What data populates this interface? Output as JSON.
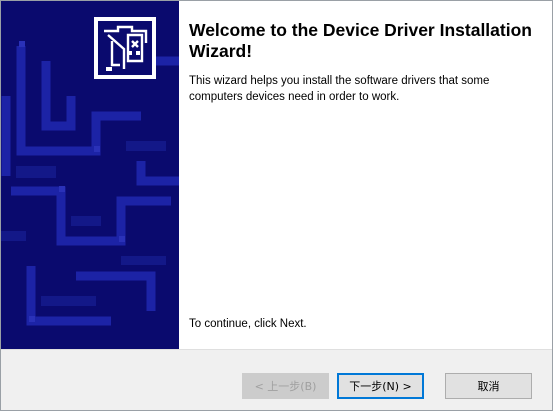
{
  "wizard": {
    "title": "Welcome to the Device Driver Installation Wizard!",
    "description": "This wizard helps you install the software drivers that some computers devices need in order to work.",
    "continue_text": "To continue, click Next.",
    "logo_icon": "device-driver-logo-icon"
  },
  "buttons": {
    "back_label": "< 上一步(B)",
    "next_label": "下一步(N) >",
    "cancel_label": "取消"
  },
  "colors": {
    "panel_background": "#0a0a6e",
    "panel_pattern": "#1a1f9a",
    "footer_background": "#f0f0f0",
    "default_button_border": "#0078d7"
  }
}
